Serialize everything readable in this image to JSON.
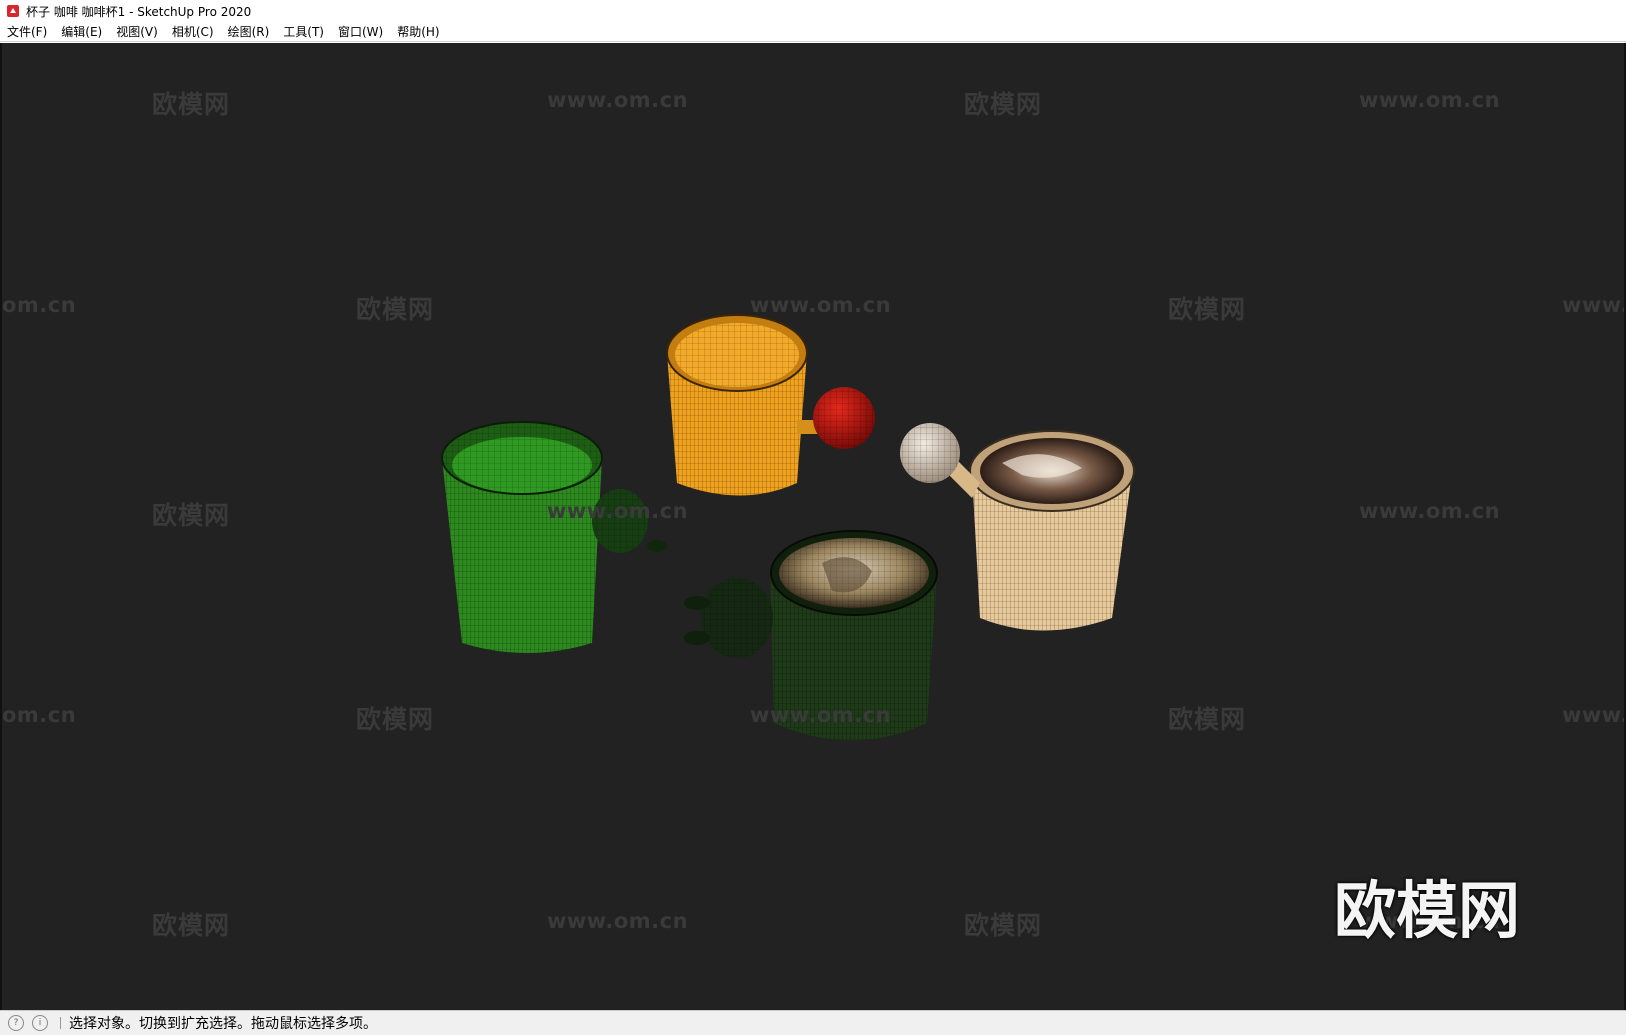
{
  "window": {
    "title": "杯子 咖啡 咖啡杯1 - SketchUp Pro 2020"
  },
  "menu": {
    "items": [
      "文件(F)",
      "编辑(E)",
      "视图(V)",
      "相机(C)",
      "绘图(R)",
      "工具(T)",
      "窗口(W)",
      "帮助(H)"
    ]
  },
  "watermarks": {
    "brand": "欧模网",
    "url": "www.om.cn",
    "partial_url_left": "om.cn",
    "partial_url_right": "www."
  },
  "status": {
    "text": "选择对象。切换到扩充选择。拖动鼠标选择多项。",
    "icon_geo": "geo-location-icon",
    "icon_info": "info-icon"
  },
  "colors": {
    "viewport_bg": "#222222",
    "cup_green": "#2c8a1e",
    "cup_orange": "#f0a21e",
    "cup_beige": "#e8c99a",
    "cup_darkgreen": "#1e3a18",
    "ball_red": "#c8150f"
  }
}
